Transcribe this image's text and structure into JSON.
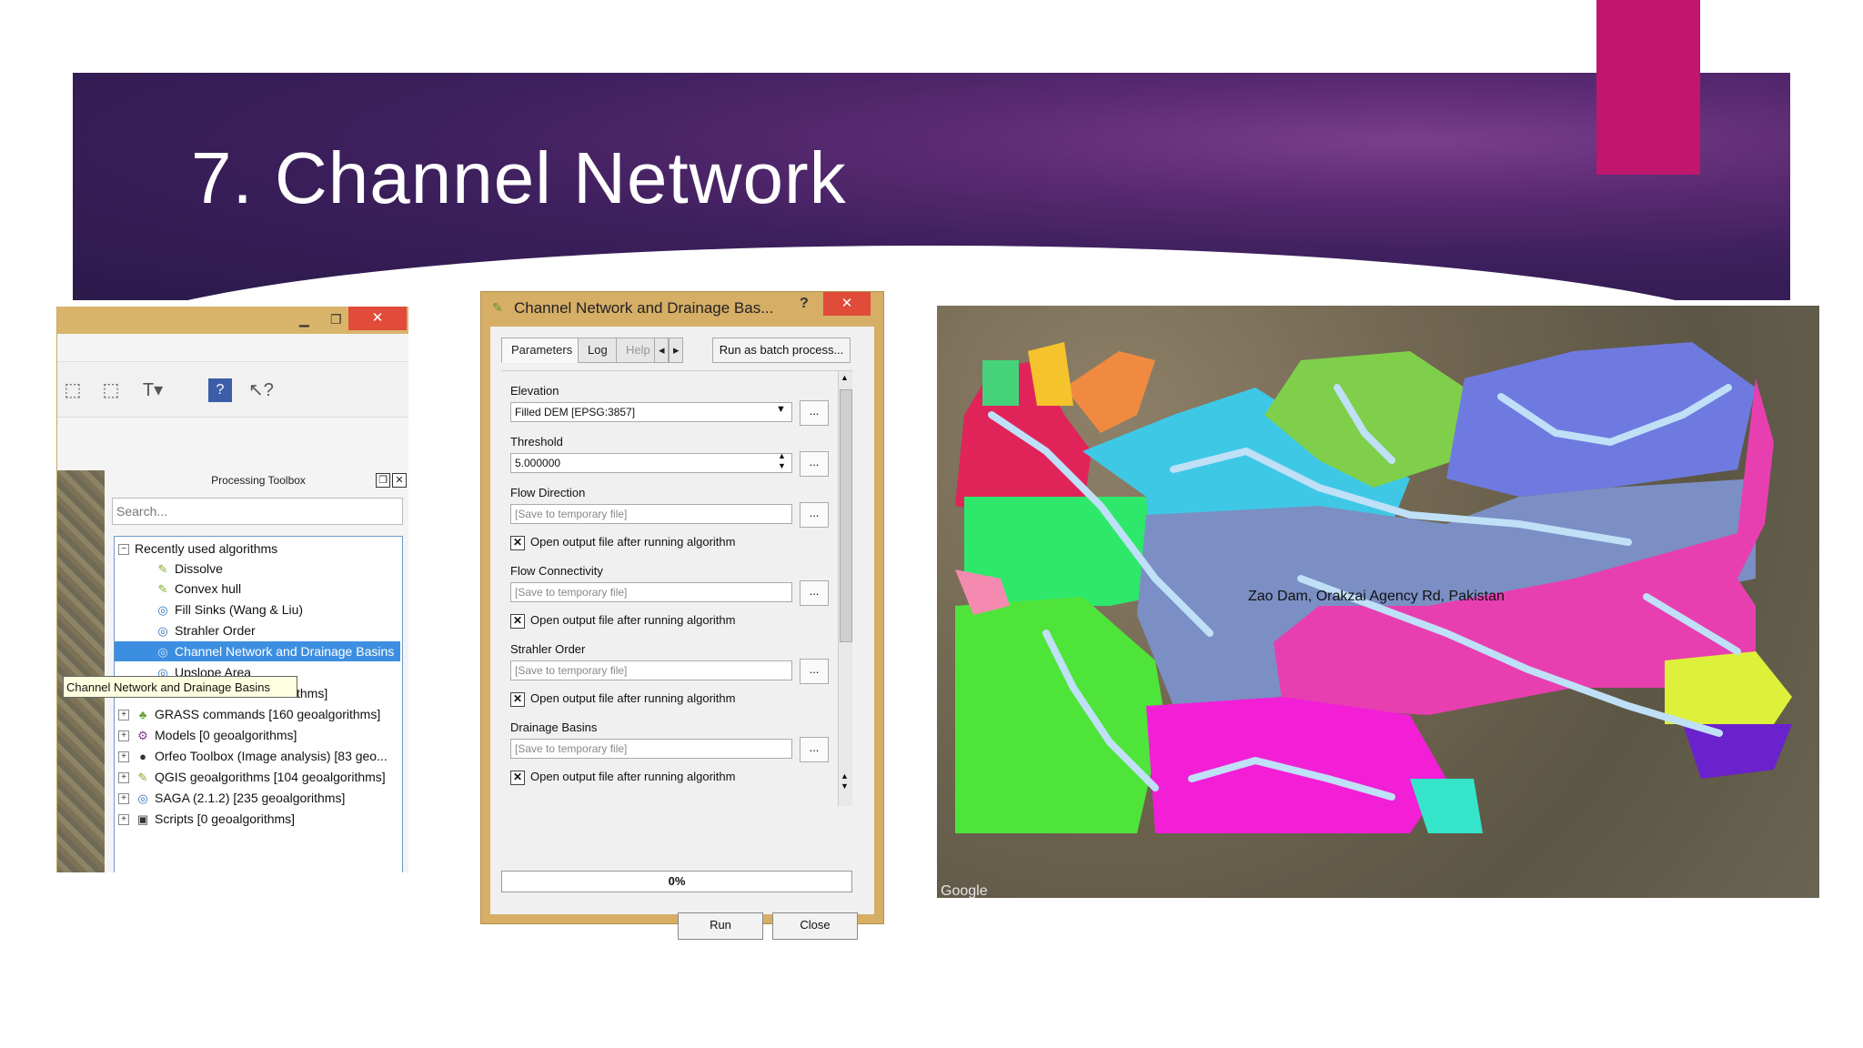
{
  "slide": {
    "title": "7. Channel Network",
    "colors": {
      "banner": "#3c1f5c",
      "accent": "#c0166e"
    }
  },
  "qgis_window": {
    "toolbar_icons": [
      "add-layer-icon",
      "new-layer-icon",
      "text-annotation-icon",
      "help-icon",
      "whats-this-icon"
    ],
    "toolbox": {
      "title": "Processing Toolbox",
      "search_placeholder": "Search...",
      "tree": {
        "recent_label": "Recently used algorithms",
        "recent_items": [
          "Dissolve",
          "Convex hull",
          "Fill Sinks (Wang & Liu)",
          "Strahler Order",
          "Channel Network and Drainage Basins",
          "Upslope Area"
        ],
        "partial_hidden_label": "thms]",
        "providers": [
          "GRASS commands [160 geoalgorithms]",
          "Models [0 geoalgorithms]",
          "Orfeo Toolbox (Image analysis) [83 geo...",
          "QGIS geoalgorithms [104 geoalgorithms]",
          "SAGA (2.1.2) [235 geoalgorithms]",
          "Scripts [0 geoalgorithms]"
        ]
      },
      "tooltip": "Channel Network and Drainage Basins"
    }
  },
  "dialog": {
    "title": "Channel Network and Drainage Bas...",
    "help_glyph": "?",
    "tabs": [
      "Parameters",
      "Log",
      "Help (I"
    ],
    "batch_label": "Run as batch process...",
    "params": [
      {
        "label": "Elevation",
        "value": "Filled DEM [EPSG:3857]"
      },
      {
        "label": "Threshold",
        "value": "5.000000"
      },
      {
        "label": "Flow Direction",
        "value": "[Save to temporary file]"
      },
      {
        "label": "Flow Connectivity",
        "value": "[Save to temporary file]"
      },
      {
        "label": "Strahler Order",
        "value": "[Save to temporary file]"
      },
      {
        "label": "Drainage Basins",
        "value": "[Save to temporary file]"
      }
    ],
    "open_output_label": "Open output file after running algorithm",
    "ellipsis": "...",
    "progress_text": "0%",
    "progress_value": 0,
    "run_label": "Run",
    "close_label": "Close"
  },
  "map": {
    "place_label": "Zao Dam, Orakzai Agency Rd, Pakistan",
    "logo": "Google"
  }
}
